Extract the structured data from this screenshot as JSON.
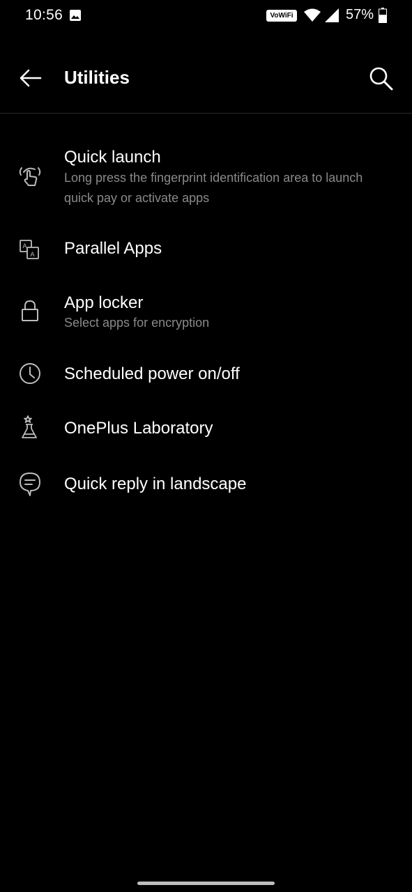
{
  "status_bar": {
    "time": "10:56",
    "vowifi": "VoWiFi",
    "battery_percent": "57%",
    "battery_level": 0.57,
    "icons": [
      "image-icon",
      "wifi-icon",
      "signal-icon",
      "battery-icon"
    ]
  },
  "app_bar": {
    "title": "Utilities",
    "icons": [
      "back-arrow-icon",
      "search-icon"
    ]
  },
  "items": [
    {
      "title": "Quick launch",
      "summary": "Long press the fingerprint identification area to launch quick pay or activate apps",
      "icon": "fingerprint-touch-icon"
    },
    {
      "title": "Parallel Apps",
      "summary": "",
      "icon": "parallel-apps-icon"
    },
    {
      "title": "App locker",
      "summary": "Select apps for encryption",
      "icon": "lock-icon"
    },
    {
      "title": "Scheduled power on/off",
      "summary": "",
      "icon": "clock-icon"
    },
    {
      "title": "OnePlus Laboratory",
      "summary": "",
      "icon": "flask-icon"
    },
    {
      "title": "Quick reply in landscape",
      "summary": "",
      "icon": "chat-bubble-icon"
    }
  ],
  "colors": {
    "background": "#000000",
    "text_primary": "#ffffff",
    "text_secondary": "#8a8a8a",
    "icon": "#bdbdbd"
  }
}
